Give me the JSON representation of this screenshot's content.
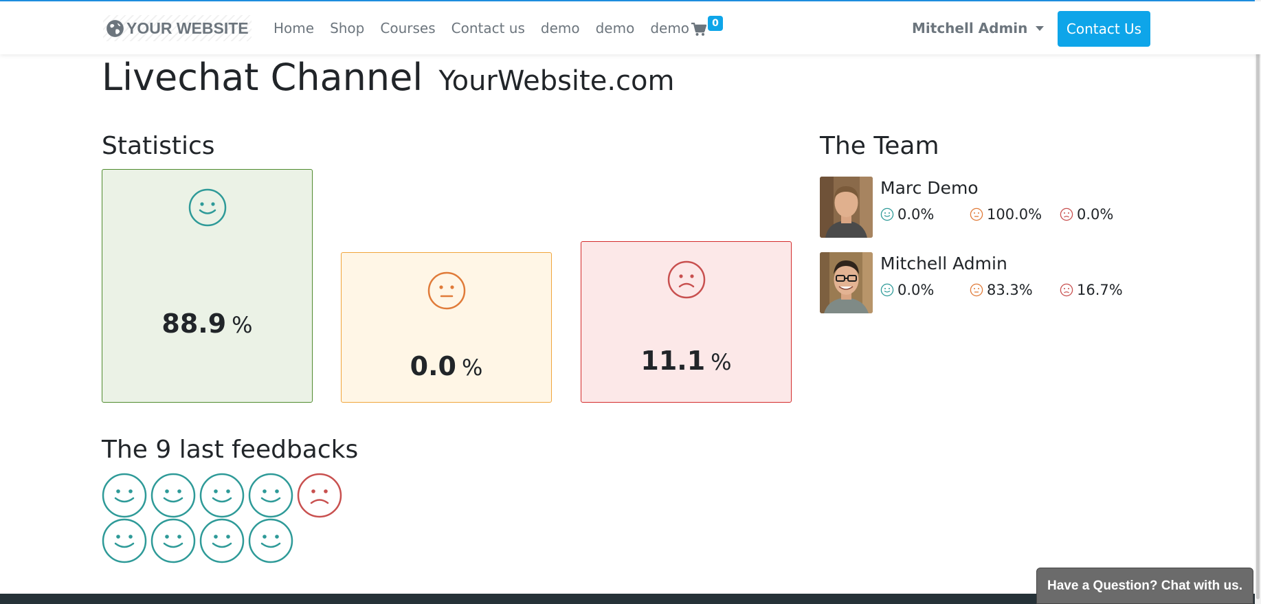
{
  "colors": {
    "accent": "#0ea5e9",
    "happy": "#2e9a98",
    "neutral": "#e07b39",
    "unhappy": "#c8504f",
    "happy_border": "#4e8a2c",
    "neutral_border": "#f0a43a",
    "unhappy_border": "#d32a2a"
  },
  "navbar": {
    "logo_text": "YOUR WEBSITE",
    "logo_icon": "globe-icon",
    "menu": [
      "Home",
      "Shop",
      "Courses",
      "Contact us",
      "demo",
      "demo",
      "demo"
    ],
    "cart_icon": "shopping-cart-icon",
    "cart_count": "0",
    "user_name": "Mitchell Admin",
    "cta_label": "Contact Us"
  },
  "page": {
    "title": "Livechat Channel",
    "subtitle": "YourWebsite.com"
  },
  "statistics": {
    "heading": "Statistics",
    "items": [
      {
        "icon": "happy-face-icon",
        "value": "88.9",
        "unit": "%"
      },
      {
        "icon": "neutral-face-icon",
        "value": "0.0",
        "unit": "%"
      },
      {
        "icon": "unhappy-face-icon",
        "value": "11.1",
        "unit": "%"
      }
    ]
  },
  "team": {
    "heading": "The Team",
    "members": [
      {
        "name": "Marc Demo",
        "happy": "0.0%",
        "neutral": "100.0%",
        "unhappy": "0.0%"
      },
      {
        "name": "Mitchell Admin",
        "happy": "0.0%",
        "neutral": "83.3%",
        "unhappy": "16.7%"
      }
    ]
  },
  "feedbacks": {
    "heading": "The 9 last feedbacks",
    "items": [
      "happy",
      "happy",
      "happy",
      "happy",
      "unhappy",
      "happy",
      "happy",
      "happy",
      "happy"
    ]
  },
  "chat": {
    "button_label": "Have a Question? Chat with us."
  }
}
